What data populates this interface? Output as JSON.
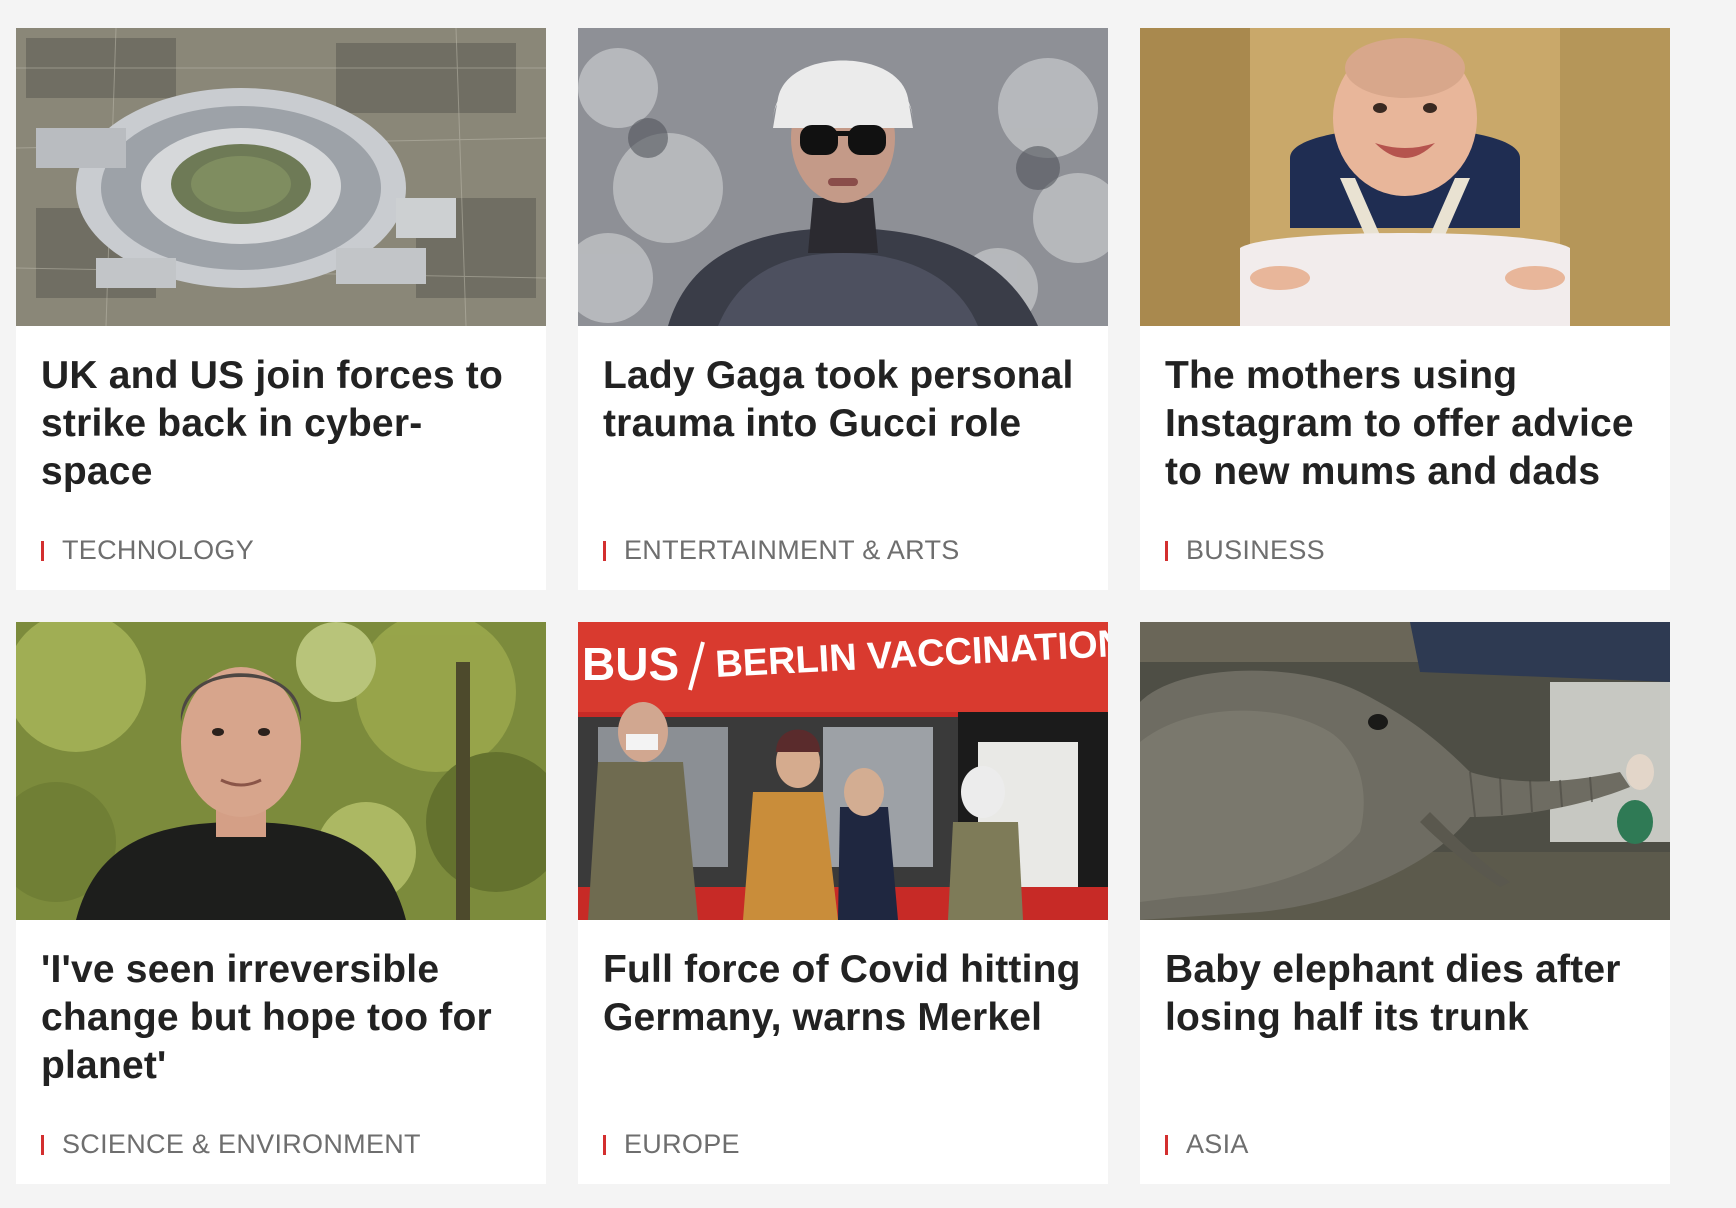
{
  "accent_color": "#d32f2f",
  "cards": [
    {
      "headline": "UK and US join forces to strike back in cyber-space",
      "section": "TECHNOLOGY",
      "image_icon": "aerial-ring-building-image"
    },
    {
      "headline": "Lady Gaga took personal trauma into Gucci role",
      "section": "ENTERTAINMENT & ARTS",
      "image_icon": "woman-fur-hat-image"
    },
    {
      "headline": "The mothers using Instagram to offer advice to new mums and dads",
      "section": "BUSINESS",
      "image_icon": "baby-high-chair-image"
    },
    {
      "headline": "'I've seen irreversible change but hope too for planet'",
      "section": "SCIENCE & ENVIRONMENT",
      "image_icon": "man-forest-portrait-image"
    },
    {
      "headline": "Full force of Covid hitting Germany, warns Merkel",
      "section": "EUROPE",
      "image_icon": "vaccination-bus-image",
      "image_text_left": "BUS",
      "image_text_right": "BERLIN VACCINATION"
    },
    {
      "headline": "Baby elephant dies after losing half its trunk",
      "section": "ASIA",
      "image_icon": "baby-elephant-image"
    }
  ]
}
